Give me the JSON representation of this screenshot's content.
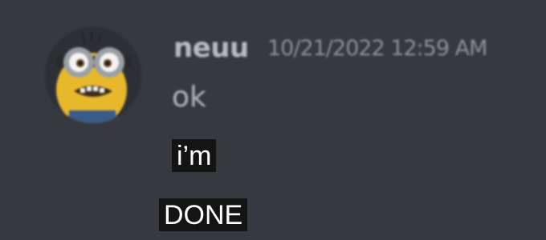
{
  "message": {
    "author": "neuu",
    "timestamp": "10/21/2022 12:59 AM",
    "text": "ok",
    "avatar_icon": "minion-avatar-icon"
  },
  "captions": [
    "i’m",
    "DONE"
  ],
  "colors": {
    "background": "#36393f",
    "username": "#b9bbbe",
    "timestamp": "#8e9297",
    "message_text": "#b4b6b9",
    "caption_bg": "#141414",
    "caption_text": "#ffffff"
  }
}
